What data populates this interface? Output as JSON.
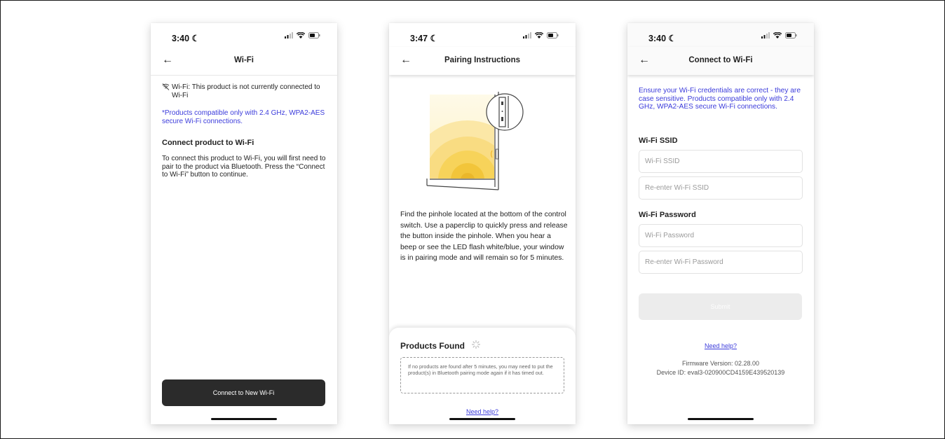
{
  "phone1": {
    "time": "3:40",
    "nav_title": "Wi-Fi",
    "status_text": "Wi-Fi: This product is not currently connected to Wi-Fi",
    "compat_note": "*Products compatible only with 2.4 GHz, WPA2-AES secure Wi-Fi connections.",
    "section_heading": "Connect product to Wi-Fi",
    "section_body": "To connect this product to Wi-Fi, you will first need to pair to the product via Bluetooth. Press the “Connect to Wi-Fi” button to continue.",
    "button_label": "Connect to New Wi-Fi"
  },
  "phone2": {
    "time": "3:47",
    "nav_title": "Pairing Instructions",
    "instructions": "Find the pinhole located at the bottom of the control switch. Use a paperclip to quickly press and release the button inside the pinhole. When you hear a beep or see the LED flash white/blue, your window is in pairing mode and will remain so for 5 minutes.",
    "panel_title": "Products Found",
    "panel_info": "If no products are found after 5 minutes, you may need to put the product(s) in Bluetooth pairing mode again if it has timed out.",
    "help_link": "Need help?"
  },
  "phone3": {
    "time": "3:40",
    "nav_title": "Connect to Wi-Fi",
    "note": "Ensure your Wi-Fi credentials are correct - they are case sensitive. Products compatible only with 2.4 GHz, WPA2-AES secure Wi-Fi connections.",
    "ssid_label": "Wi-Fi SSID",
    "ssid_placeholder": "Wi-Fi SSID",
    "ssid_confirm_placeholder": "Re-enter Wi-Fi SSID",
    "password_label": "Wi-Fi Password",
    "password_placeholder": "Wi-Fi Password",
    "password_confirm_placeholder": "Re-enter Wi-Fi Password",
    "submit_label": "Submit",
    "help_link": "Need help?",
    "firmware": "Firmware Version: 02.28.00",
    "device_id": "Device ID: eval3-020900CD4159E439520139"
  },
  "colors": {
    "link_blue": "#3b3bdb",
    "button_dark": "#2b2b2b",
    "button_disabled": "#ececec",
    "illustration_yellow": "#f7d35a"
  },
  "icons": [
    "moon-icon",
    "signal-icon",
    "wifi-icon",
    "battery-icon",
    "back-arrow-icon",
    "wifi-off-icon",
    "spinner-icon"
  ]
}
